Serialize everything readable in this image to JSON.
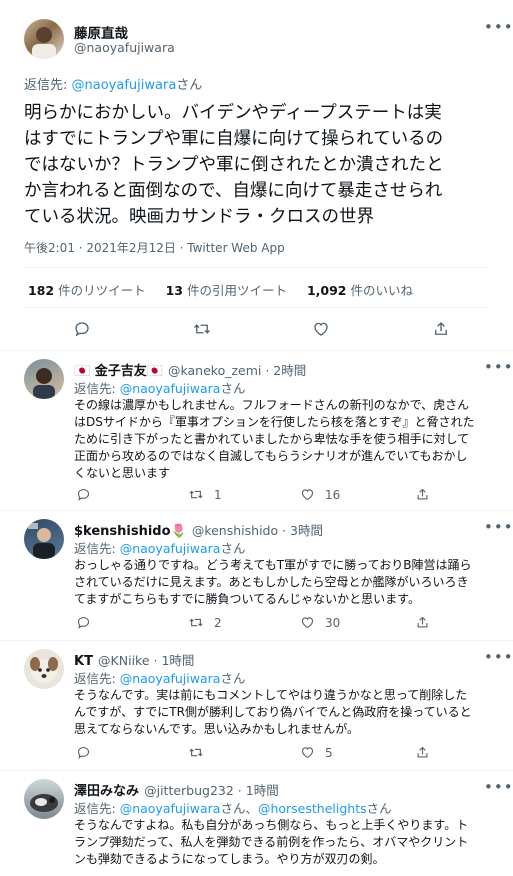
{
  "main_tweet": {
    "name": "藤原直哉",
    "handle": "@naoyafujiwara",
    "reply_prefix": "返信先: ",
    "reply_to": "@naoyafujiwara",
    "reply_suffix": "さん",
    "text_lines": [
      "明らかにおかしい。バイデンやディープステートは実",
      "はすでにトランプや軍に自爆に向けて操られているの",
      "ではないか？トランプや軍に倒されたとか潰されたと",
      "か言われると面倒なので、自爆に向けて暴走させられ",
      "ている状況。映画カサンドラ・クロスの世界"
    ],
    "timestamp": "午後2:01 · 2021年2月12日 · Twitter Web App",
    "stats": {
      "retweets_count": "182",
      "retweets_label": "件のリツイート",
      "quotes_count": "13",
      "quotes_label": "件の引用ツイート",
      "likes_count": "1,092",
      "likes_label": "件のいいね"
    }
  },
  "replies": [
    {
      "name": "🇯🇵 金子吉友🇯🇵",
      "handle": "@kaneko_zemi · 2時間",
      "reply_prefix": "返信先: ",
      "reply_to": "@naoyafujiwara",
      "reply_to2": "",
      "reply_suffix": "さん",
      "text_lines": [
        "その線は濃厚かもしれません。フルフォードさんの新刊のなかで、虎さん",
        "はDSサイドから『軍事オプションを行使したら核を落とすぞ』と脅された",
        "ために引き下がったと書かれていましたから卑怯な手を使う相手に対して",
        "正面から攻めるのではなく自滅してもらうシナリオが進んでいてもおかし",
        "くないと思います"
      ],
      "retweets": "1",
      "likes": "16"
    },
    {
      "name": "$kenshishido🌷",
      "handle": "@kenshishido · 3時間",
      "reply_prefix": "返信先: ",
      "reply_to": "@naoyafujiwara",
      "reply_to2": "",
      "reply_suffix": "さん",
      "text_lines": [
        "おっしゃる通りですね。どう考えてもT軍がすでに勝っておりB陣営は踊ら",
        "されているだけに見えます。あともしかしたら空母とか艦隊がいろいろき",
        "てますがこちらもすでに勝負ついてるんじゃないかと思います。"
      ],
      "retweets": "2",
      "likes": "30"
    },
    {
      "name": "KT",
      "handle": "@KNiike · 1時間",
      "reply_prefix": "返信先: ",
      "reply_to": "@naoyafujiwara",
      "reply_to2": "",
      "reply_suffix": "さん",
      "text_lines": [
        "そうなんです。実は前にもコメントしてやはり違うかなと思って削除した",
        "んですが、すでにTR側が勝利しており偽バイでんと偽政府を操っていると",
        "思えてならないんです。思い込みかもしれませんが。"
      ],
      "retweets": "",
      "likes": "5"
    },
    {
      "name": "澤田みなみ",
      "handle": "@jitterbug232 · 1時間",
      "reply_prefix": "返信先: ",
      "reply_to": "@naoyafujiwara",
      "reply_to2": "@horsesthelights",
      "reply_sep": "さん、",
      "reply_suffix": "さん",
      "text_lines": [
        "そうなんですよね。私も自分があっち側なら、もっと上手くやります。ト",
        "ランプ弾劾だって、私人を弾劾できる前例を作ったら、オバマやクリント",
        "ンも弾劾できるようになってしまう。やり方が双刃の剣。"
      ],
      "retweets": "",
      "likes": ""
    }
  ],
  "icons": {
    "more": "more-icon",
    "reply": "reply-icon",
    "retweet": "retweet-icon",
    "like": "heart-icon",
    "share": "share-icon"
  },
  "colors": {
    "accent": "#1d9bf0",
    "text": "#0f1419",
    "secondary": "#536471",
    "divider": "#eff3f4"
  }
}
